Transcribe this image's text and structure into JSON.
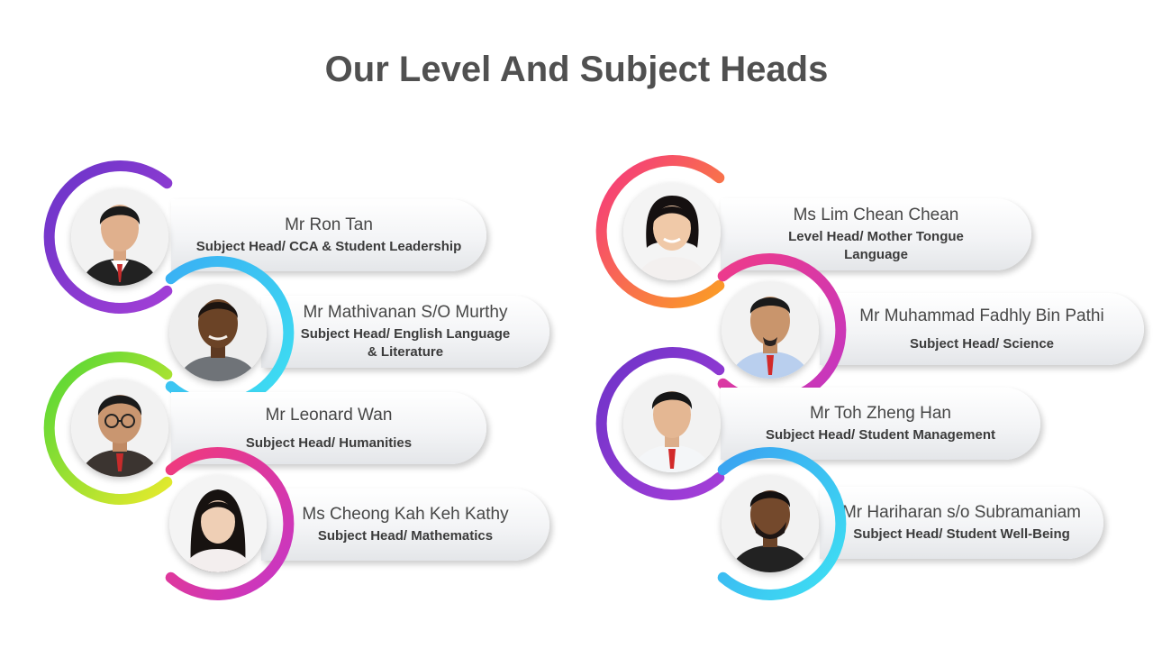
{
  "page": {
    "title": "Our Level And Subject Heads"
  },
  "people": [
    {
      "name": "Mr Ron Tan",
      "role": "Subject Head/ CCA & Student Leadership",
      "ring_colors": [
        "#6a34c9",
        "#a23fd6"
      ]
    },
    {
      "name": "Mr Mathivanan S/O Murthy",
      "role": "Subject Head/ English Language",
      "role_line2": "& Literature",
      "ring_colors": [
        "#3ab0f3",
        "#3ee0f2"
      ]
    },
    {
      "name": "Mr Leonard Wan",
      "role": "Subject Head/ Humanities",
      "ring_colors": [
        "#4fd636",
        "#e6ea2d"
      ]
    },
    {
      "name": "Ms Cheong Kah Keh Kathy",
      "role": "Subject Head/ Mathematics",
      "ring_colors": [
        "#f03a7c",
        "#c536c9"
      ]
    },
    {
      "name": "Ms Lim Chean Chean",
      "role": "Level Head/ Mother Tongue",
      "role_line2": "Language",
      "ring_colors": [
        "#f5367f",
        "#fb9d25"
      ]
    },
    {
      "name": "Mr Muhammad Fadhly Bin Pathi",
      "role": "Subject Head/ Science",
      "ring_colors": [
        "#ee3b8a",
        "#c236c3"
      ]
    },
    {
      "name": "Mr Toh Zheng Han",
      "role": "Subject Head/ Student Management",
      "ring_colors": [
        "#6d33c8",
        "#a53ed8"
      ]
    },
    {
      "name": "Mr Hariharan s/o Subramaniam",
      "role": "Subject Head/ Student Well-Being",
      "ring_colors": [
        "#3aa2f1",
        "#3ee2f3"
      ]
    }
  ]
}
